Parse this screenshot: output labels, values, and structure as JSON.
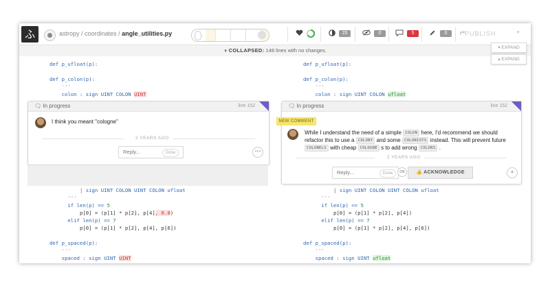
{
  "toolbar": {
    "repo": "astropy",
    "folder": "coordinates",
    "file": "angle_utilities.py",
    "badge_gray_1": "25",
    "badge_gray_2": "0",
    "badge_red": "5",
    "badge_gray_3": "0",
    "publish_label": "PUBLISH",
    "logo_glyph": "ふ"
  },
  "collapsed": {
    "label": "COLLAPSED:",
    "text": "148 lines with no changes."
  },
  "expand_label": "EXPAND",
  "left_code_top": {
    "l1": "def p_ufloat(p):",
    "l2": "def p_colon(p):",
    "l3": "'''",
    "l4": "colon : sign UINT COLON ",
    "l4_hl": "UINT"
  },
  "right_code_top": {
    "l1": "def p_ufloat(p):",
    "l2": "def p_colon(p):",
    "l3": "'''",
    "l4": "colon : sign UINT COLON ",
    "l4_hl": "ufloat"
  },
  "left_comment": {
    "status": "In progress",
    "line": "line 152",
    "text": "I think you meant \"cologne\"",
    "time": "2 YEARS AGO",
    "reply_placeholder": "Reply...",
    "done": "Done",
    "more": "•••"
  },
  "right_comment": {
    "status": "In progress",
    "line": "line 152",
    "new_label": "NEW COMMENT",
    "t1": "While I understand the need of a simple ",
    "tag1": "COLON",
    "t2": " here, I'd recommend we should",
    "t3": "refactor this to use a ",
    "tag2": "COLONY",
    "t4": " and some ",
    "tag3": "COLONISTS",
    "t5": " instead. This will prevent future",
    "tag4": "COLONELS",
    "t6": " with cheap ",
    "tag5": "COLOGNE",
    "t7": " s to add wrong ",
    "tag6": "COLORS",
    "t8": " .",
    "time": "2 YEARS AGO",
    "reply_placeholder": "Reply...",
    "done": "Done",
    "or": "OR",
    "ack": "ACKNOWLEDGE",
    "plus": "+"
  },
  "left_code_bottom": {
    "a1": "| sign UINT COLON UINT COLON ufloat",
    "a2": "'''",
    "a3": "if len(p) == ",
    "a3n": "5",
    "a4": "p[0] = (p[1] * p[2], p[4]",
    "a4hl": ", 0.0",
    "a4e": ")",
    "a5": "elif len(p) == ",
    "a5n": "7",
    "a6": "p[0] = (p[1] * p[2], p[4], p[6])",
    "b1": "def p_spaced(p):",
    "b2": "'''",
    "b3": "spaced : sign UINT ",
    "b3hl": "UINT"
  },
  "right_code_bottom": {
    "a1": "| sign UINT COLON UINT COLON ufloat",
    "a2": "'''",
    "a3": "if len(p) == ",
    "a3n": "5",
    "a4": "p[0] = (p[1] * p[2], p[4])",
    "a5": "elif len(p) == ",
    "a5n": "7",
    "a6": "p[0] = (p[1] * p[2], p[4], p[6])",
    "b1": "def p_spaced(p):",
    "b2": "'''",
    "b3": "spaced : sign UINT ",
    "b3hl": "ufloat"
  }
}
